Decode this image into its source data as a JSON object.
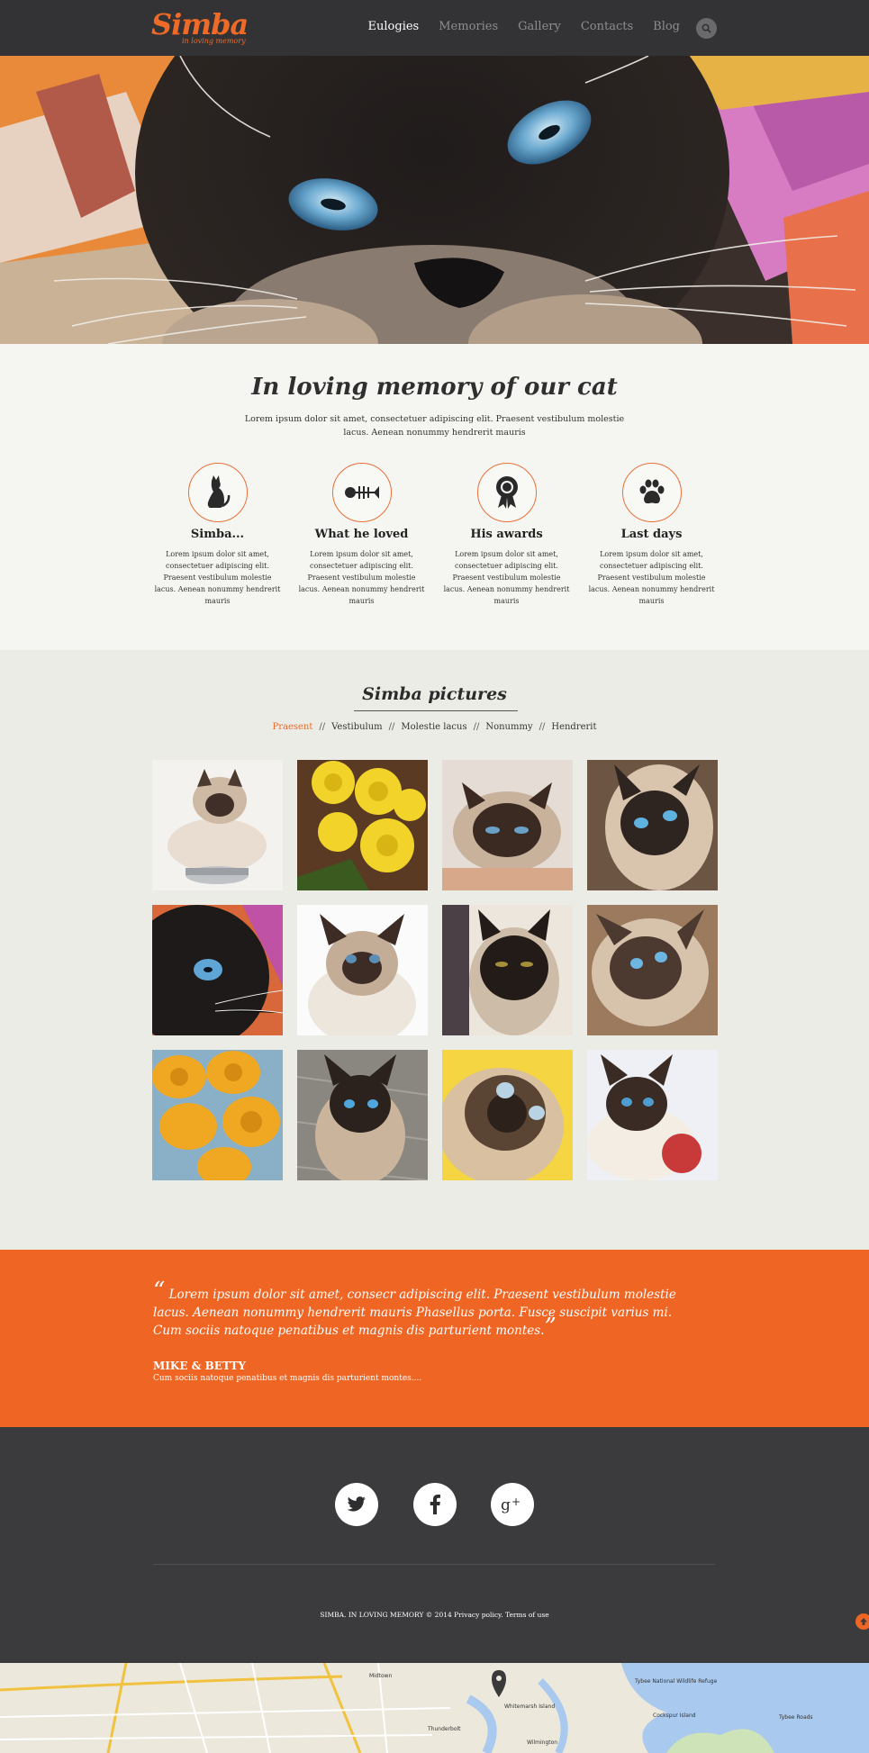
{
  "header": {
    "logo_main": "Simba",
    "logo_sub": "in loving memory",
    "nav": [
      "Eulogies",
      "Memories",
      "Gallery",
      "Contacts",
      "Blog"
    ],
    "active_nav": "Eulogies",
    "search_icon": "search-icon"
  },
  "intro": {
    "title": "In loving memory of our cat",
    "text": "Lorem ipsum dolor sit amet, consectetuer adipiscing elit. Praesent vestibulum molestie lacus. Aenean nonummy hendrerit mauris",
    "features": [
      {
        "title": "Simba...",
        "icon": "cat-icon",
        "text": "Lorem ipsum dolor sit amet, consectetuer adipiscing elit. Praesent vestibulum molestie lacus. Aenean nonummy hendrerit mauris"
      },
      {
        "title": "What he loved",
        "icon": "fish-bone-icon",
        "text": "Lorem ipsum dolor sit amet, consectetuer adipiscing elit. Praesent vestibulum molestie lacus. Aenean nonummy hendrerit mauris"
      },
      {
        "title": "His awards",
        "icon": "award-icon",
        "text": "Lorem ipsum dolor sit amet, consectetuer adipiscing elit. Praesent vestibulum molestie lacus. Aenean nonummy hendrerit mauris"
      },
      {
        "title": "Last days",
        "icon": "paw-icon",
        "text": "Lorem ipsum dolor sit amet, consectetuer adipiscing elit. Praesent vestibulum molestie lacus. Aenean nonummy hendrerit mauris"
      }
    ]
  },
  "gallery": {
    "title": "Simba pictures",
    "filters": [
      "Praesent",
      "Vestibulum",
      "Molestie lacus",
      "Nonummy",
      "Hendrerit"
    ],
    "separator": "//",
    "active_filter": "Praesent"
  },
  "testimonial": {
    "open_quote": "“",
    "close_quote": "”",
    "text": "Lorem ipsum dolor sit amet, consecr adipiscing elit. Praesent vestibulum molestie lacus. Aenean nonummy hendrerit mauris Phasellus porta. Fusce suscipit varius mi. Cum sociis natoque penatibus et magnis dis parturient montes.",
    "author": "MIKE & BETTY",
    "subtitle": "Cum sociis natoque penatibus et magnis dis parturient montes...."
  },
  "footer": {
    "social": [
      "twitter-icon",
      "facebook-icon",
      "google-plus-icon"
    ],
    "copyright_brand": "SIMBA. IN LOVING MEMORY",
    "copyright_year": "© 2014",
    "privacy": "Privacy policy.",
    "terms": "Terms of use"
  },
  "map": {
    "labels": [
      "Midtown",
      "Tybee National Wildlife Refuge",
      "Cockspur Island",
      "Tybee Roads",
      "Thunderbolt",
      "Whitemarsh Island",
      "Wilmington"
    ]
  },
  "colors": {
    "accent": "#ef6524",
    "header_bg": "#333335",
    "intro_bg": "#f5f5f1",
    "gallery_bg": "#ecece6",
    "footer_bg": "#3b3b3d"
  }
}
